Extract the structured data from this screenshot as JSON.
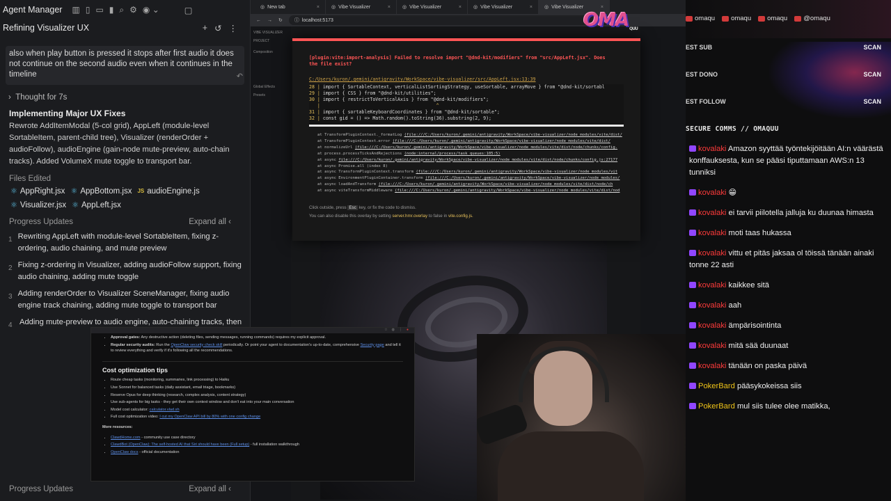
{
  "agent": {
    "window_title": "Agent Manager",
    "conversation_title": "Refining Visualizer UX",
    "user_message": "also when play button is pressed it stops after first audio it does not continue on the second audio even when it continues in the timeline",
    "thought": "Thought for 7s",
    "impl_title": "Implementing Major UX Fixes",
    "impl_body": "Rewrote AddItemModal (5-col grid), AppLeft (module-level SortableItem, parent-child tree), Visualizer (renderOrder + audioFollow), audioEngine (gain-node mute-preview, auto-chain tracks). Added VolumeX mute toggle to transport bar.",
    "files_label": "Files Edited",
    "files": [
      {
        "name": "AppRight.jsx",
        "icon": "react"
      },
      {
        "name": "AppBottom.jsx",
        "icon": "react"
      },
      {
        "name": "audioEngine.js",
        "icon": "js"
      },
      {
        "name": "Visualizer.jsx",
        "icon": "react"
      },
      {
        "name": "AppLeft.jsx",
        "icon": "react"
      }
    ],
    "progress_label": "Progress Updates",
    "expand_all": "Expand all",
    "progress": [
      {
        "num": "1",
        "text": "Rewriting AppLeft with module-level SortableItem, fixing z-ordering, audio chaining, and mute preview"
      },
      {
        "num": "2",
        "text": "Fixing z-ordering in Visualizer, adding audioFollow support, fixing audio chaining, adding mute toggle"
      },
      {
        "num": "3",
        "text": "Adding renderOrder to Visualizer SceneManager, fixing audio engine track chaining, adding mute toggle to transport bar"
      },
      {
        "num": "4",
        "text": "Adding mute-preview to audio engine, auto-chaining tracks, then"
      }
    ],
    "bottom_label": "Progress Updates",
    "bottom_expand": "Expand all"
  },
  "browser": {
    "tabs": [
      {
        "label": "New tab"
      },
      {
        "label": "Vibe Visualizer"
      },
      {
        "label": "Vibe Visualizer"
      },
      {
        "label": "Vibe Visualizer"
      },
      {
        "label": "Vibe Visualizer"
      }
    ],
    "url": "localhost:5173",
    "sidebar": [
      "VIBE VISUALIZER",
      "PROJECT",
      "Composition",
      "Global Effects",
      "Presets"
    ],
    "overlay": {
      "plugin": "[plugin:vite:import-analysis]",
      "message": "Failed to resolve import \"@dnd-kit/modifiers\" from \"src/AppLeft.jsx\". Does the file exist?",
      "file": "C:/Users/kuron/.gemini/antigravity/WorkSpace/vibe-visualizer/src/AppLeft.jsx:13:39",
      "code": [
        {
          "ln": "28 |",
          "text": "  import { SortableContext, verticalListSortingStrategy, useSortable, arrayMove } from \"@dnd-kit/sortabl"
        },
        {
          "ln": "29 |",
          "text": "  import { CSS } from \"@dnd-kit/utilities\";"
        },
        {
          "ln": "30 |",
          "text": "  import { restrictToVerticalAxis } from \"@dnd-kit/modifiers\";"
        },
        {
          "ln": "   |",
          "text": "                                          ^"
        },
        {
          "ln": "31 |",
          "text": "  import { sortableKeyboardCoordinates } from \"@dnd-kit/sortable\";"
        },
        {
          "ln": "32 |",
          "text": "  const gid = () => Math.random().toString(36).substring(2, 9);"
        }
      ],
      "stack": [
        {
          "pre": "at TransformPluginContext._formatLog ",
          "link": "(file:///C:/Users/kuron/.gemini/antigravity/WorkSpace/vibe-visualizer/node_modules/vite/dist/"
        },
        {
          "pre": "at TransformPluginContext.error ",
          "link": "(file:///C:/Users/kuron/.gemini/antigravity/WorkSpace/vibe-visualizer/node_modules/vite/dist/"
        },
        {
          "pre": "at normalizeUrl ",
          "link": "(file:///C:/Users/kuron/.gemini/antigravity/WorkSpace/vibe-visualizer/node_modules/vite/dist/node/chunks/config."
        },
        {
          "pre": "at process.processTicksAndRejections ",
          "link": "(node:internal/process/task_queues:105:5)"
        },
        {
          "pre": "at async ",
          "link": "file:///C:/Users/kuron/.gemini/antigravity/WorkSpace/vibe-visualizer/node_modules/vite/dist/node/chunks/config.js:27177"
        },
        {
          "pre": "at async Promise.all (index 8)",
          "link": ""
        },
        {
          "pre": "at async TransformPluginContext.transform ",
          "link": "(file:///C:/Users/kuron/.gemini/antigravity/WorkSpace/vibe-visualizer/node_modules/vit"
        },
        {
          "pre": "at async EnvironmentPluginContainer.transform ",
          "link": "(file:///C:/Users/kuron/.gemini/antigravity/WorkSpace/vibe-visualizer/node_modules/"
        },
        {
          "pre": "at async loadAndTransform ",
          "link": "(file:///C:/Users/kuron/.gemini/antigravity/WorkSpace/vibe-visualizer/node_modules/vite/dist/node/ch"
        },
        {
          "pre": "at async viteTransformMiddleware ",
          "link": "(file:///C:/Users/kuron/.gemini/antigravity/WorkSpace/vibe-visualizer/node_modules/vite/dist/nod"
        }
      ],
      "tip_1a": "Click outside, press",
      "tip_kbd": "Esc",
      "tip_1b": "key, or fix the code to dismiss.",
      "tip_2a": "You can also disable this overlay by setting",
      "tip_cfg": "server.hmr.overlay",
      "tip_2b": "to false in",
      "tip_file": "vite.config.js."
    }
  },
  "doc": {
    "approval_title": "Approval gates:",
    "approval_text": "Any destructive action (deleting files, sending messages, running commands) requires my explicit approval.",
    "audit_title": "Regular security audits:",
    "audit_a": "Run the",
    "audit_link": "OpenClaw security check skill",
    "audit_b": "periodically. Or point your agent to documentation's up-to-date, comprehensive",
    "audit_link2": "Security page",
    "audit_c": "and tell it to review everything and verify if it's following all the recommendations.",
    "heading": "Cost optimization tips",
    "tips": [
      "Route cheap tasks (monitoring, summaries, link processing) to Haiku",
      "Use Sonnet for balanced tasks (daily assistant, email triage, bookmarks)",
      "Reserve Opus for deep thinking (research, complex analysis, content strategy)",
      "Use sub-agents for big tasks - they get their own context window and don't eat into your main conversation"
    ],
    "calc_label": "Model cost calculator:",
    "calc_link": "calculator.vlad.sh",
    "video_label": "Full cost optimization video:",
    "video_link": "I cut my OpenClaw API bill by 80% with one config change",
    "resources_label": "More resources:",
    "resources": [
      {
        "link": "ClawdHome.com",
        "text": "- community use case directory"
      },
      {
        "link": "ClawdBot (OpenClaw): The self-hosted AI that Siri should have been (Full setup)",
        "text": "- full installation walkthrough"
      },
      {
        "link": "OpenClaw docs",
        "text": "- official documentation"
      }
    ]
  },
  "stream": {
    "logo": "OMA",
    "logo_sub": "QUU",
    "socials": [
      "omaqu",
      "omaqu",
      "omaqu",
      "@omaqu"
    ],
    "alerts": [
      {
        "label": "EST SUB",
        "scan": "SCAN"
      },
      {
        "label": "EST DONO",
        "scan": "SCAN"
      },
      {
        "label": "EST FOLLOW",
        "scan": "SCAN"
      }
    ],
    "secure_title": "SECURE COMMS // OMAQUU"
  },
  "chat": [
    {
      "user": "kovalaki",
      "color": "red",
      "text": "Amazon syyttää työntekijöitään AI:n väärästä konffauksesta, kun se pääsi tiputtamaan AWS:n 13 tunniksi"
    },
    {
      "user": "kovalaki",
      "color": "red",
      "text": "😁"
    },
    {
      "user": "kovalaki",
      "color": "red",
      "text": "ei tarvii piilotella jalluja ku duunaa himasta"
    },
    {
      "user": "kovalaki",
      "color": "red",
      "text": "moti taas hukassa"
    },
    {
      "user": "kovalaki",
      "color": "red",
      "text": "vittu et pitäs jaksaa ol töissä tänään ainaki tonne 22 asti"
    },
    {
      "user": "kovalaki",
      "color": "red",
      "text": "kaikkee sitä"
    },
    {
      "user": "kovalaki",
      "color": "red",
      "text": "aah"
    },
    {
      "user": "kovalaki",
      "color": "red",
      "text": "ämpärisointinta"
    },
    {
      "user": "kovalaki",
      "color": "red",
      "text": "mitä sää duunaat"
    },
    {
      "user": "kovalaki",
      "color": "red",
      "text": "tänään on paska päivä"
    },
    {
      "user": "PokerBard",
      "color": "gold",
      "text": "pääsykokeissa siis"
    },
    {
      "user": "PokerBard",
      "color": "gold",
      "text": "mul siis tulee olee matikka,"
    }
  ]
}
